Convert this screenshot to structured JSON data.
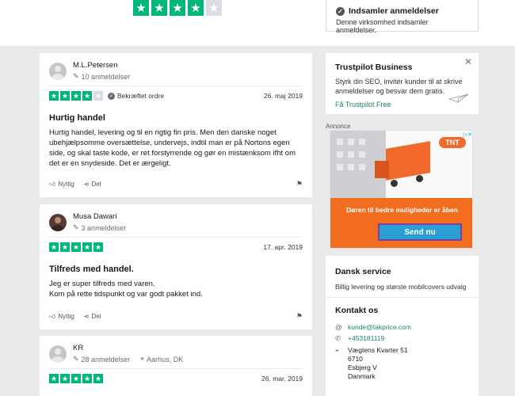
{
  "header": {
    "rating_stars": [
      true,
      true,
      true,
      true,
      false
    ],
    "collect_title": "Indsamler anmeldelser",
    "collect_sub": "Denne virksomhed indsamler anmeldelser."
  },
  "reviews": [
    {
      "name": "M.L.Petersen",
      "count": "10 anmeldelser",
      "location": "",
      "stars": 4,
      "verified": "Bekræftet ordre",
      "date": "26. maj 2019",
      "title": "Hurtig handel",
      "body": "Hurtig handel, levering og til en rigtig fin pris. Men den danske noget ubehjælpsomme oversættelse, undervejs, indtil man er på Nortons egen side, og skal taste kode, er ret forstyrrende og gør en mistænksom ifht om det er en snydeside. Det er ærgeligt.",
      "helpful": "Nyttig",
      "share": "Del"
    },
    {
      "name": "Musa Dawari",
      "count": "3 anmeldelser",
      "location": "",
      "stars": 5,
      "verified": "",
      "date": "17. apr. 2019",
      "title": "Tilfreds med handel.",
      "body": "Jeg er super tilfreds med varen.\nKom på rette tidspunkt og var godt pakket ind.",
      "helpful": "Nyttig",
      "share": "Del"
    },
    {
      "name": "KR",
      "count": "28 anmeldelser",
      "location": "Aarhus, DK",
      "stars": 5,
      "verified": "",
      "date": "26. mar. 2019",
      "title": "",
      "body": "",
      "helpful": "",
      "share": ""
    }
  ],
  "business": {
    "title": "Trustpilot Business",
    "body": "Styrk din SEO, invitér kunder til at skrive anmeldelser og besvar dem gratis.",
    "link": "Få Trustpilot Free"
  },
  "ad": {
    "label": "Annonce",
    "brand": "TNT",
    "text": "Døren til bedre muligheder er åben",
    "button": "Send nu"
  },
  "service": {
    "title": "Dansk service",
    "body": "Billig levering og største mobilcovers udvalg"
  },
  "contact": {
    "title": "Kontakt os",
    "email": "kunde@takprice.com",
    "phone": "+453181119",
    "address_line1": "Vægtens Kvarter 51",
    "address_line2": "6710",
    "address_line3": "Esbjerg V",
    "address_line4": "Danmark"
  },
  "colors": {
    "star_green": "#00b67a",
    "link_green": "#1a8757",
    "ad_orange": "#f36d21"
  }
}
